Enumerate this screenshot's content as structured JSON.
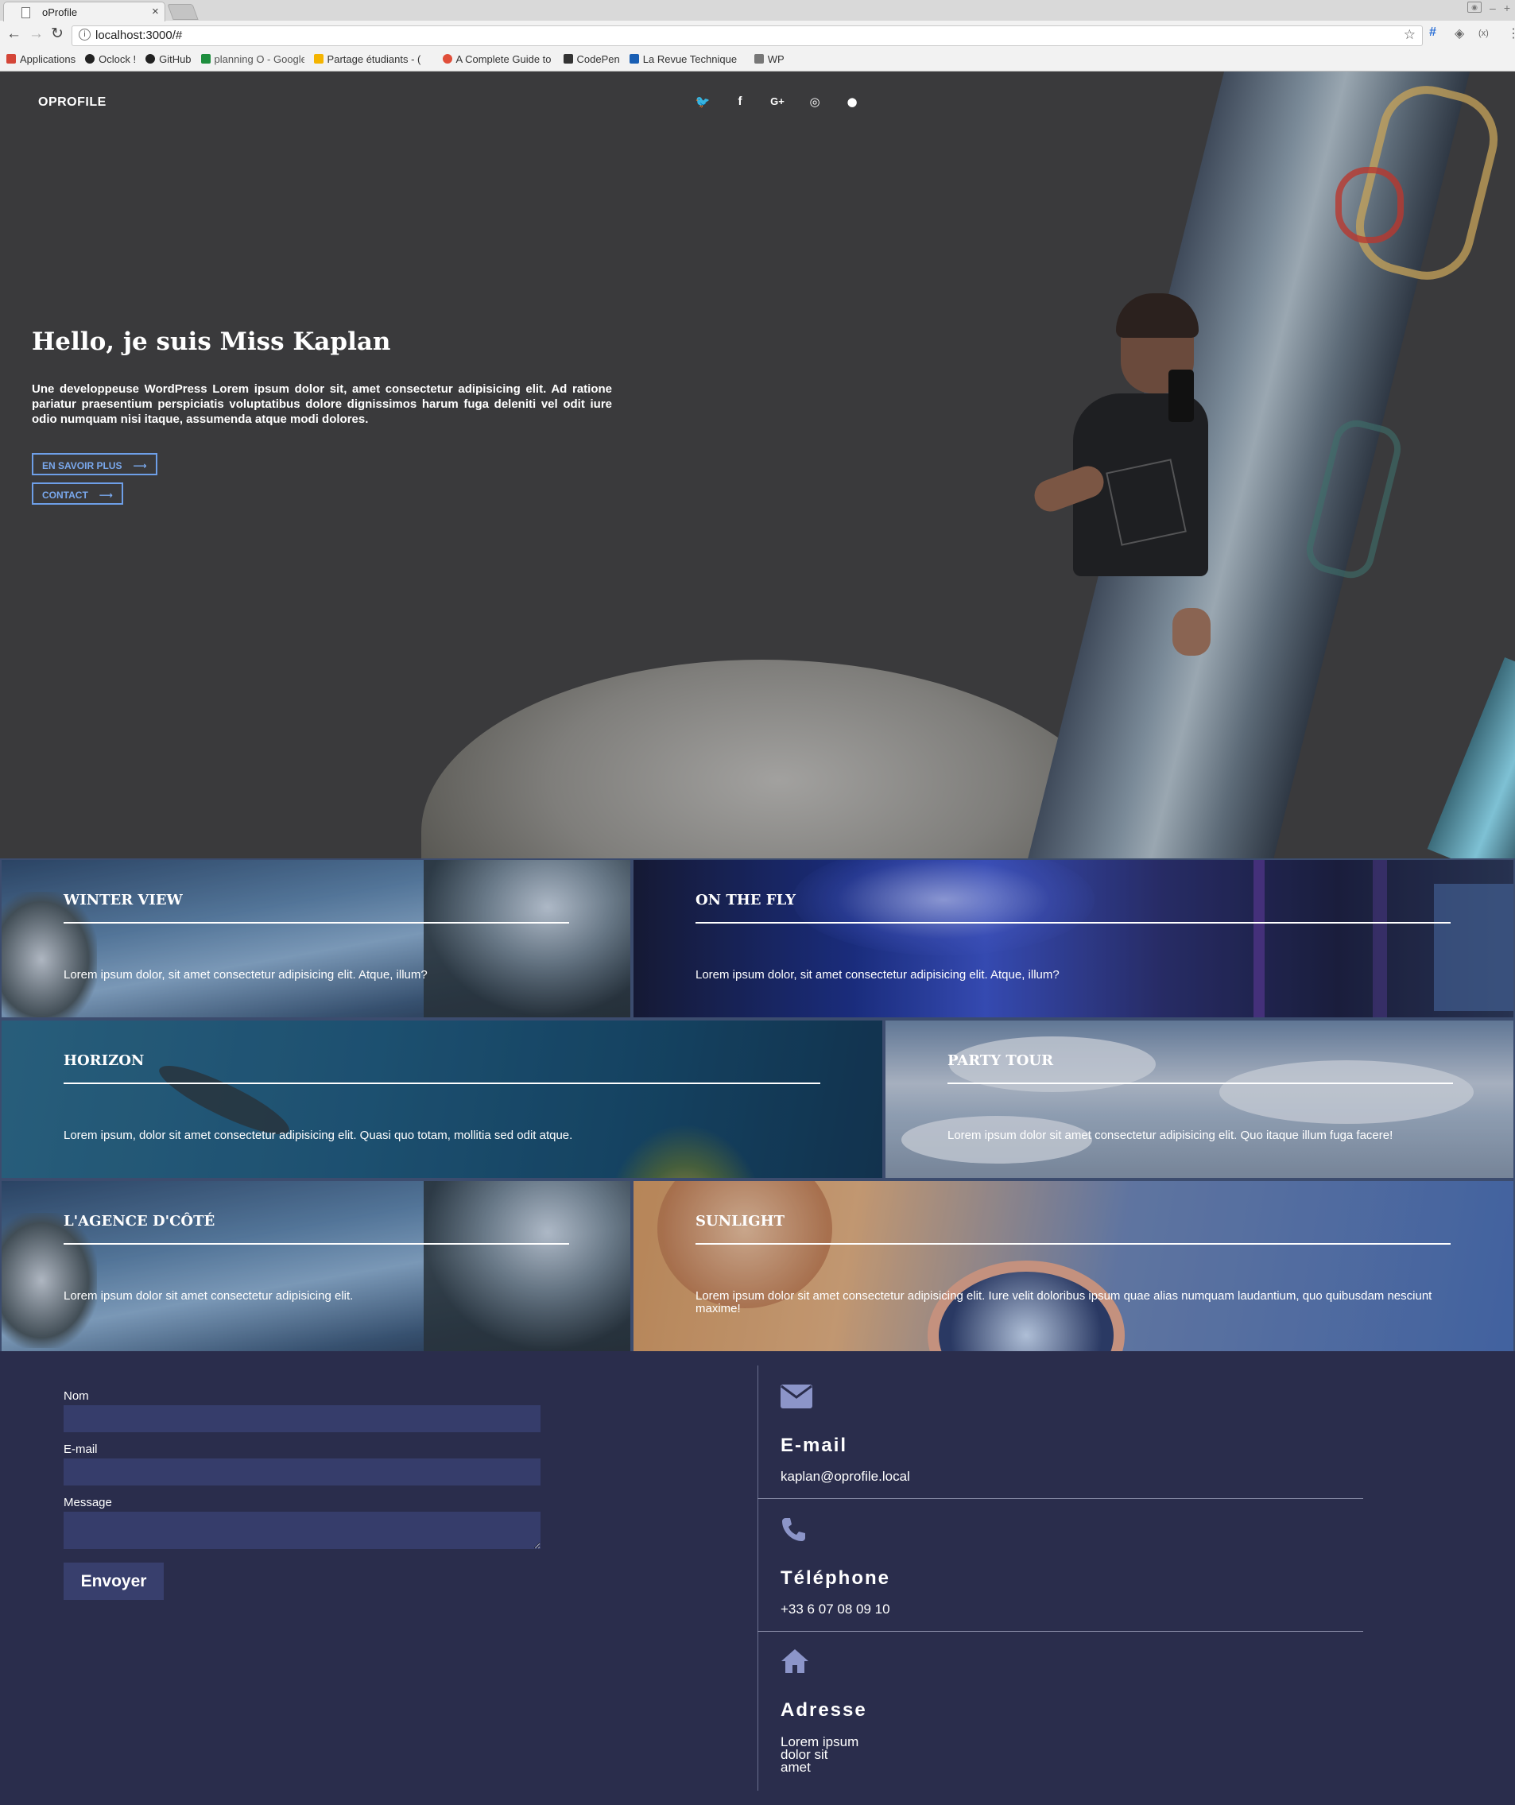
{
  "browser": {
    "tab_title": "oProfile",
    "url": "localhost:3000/#",
    "bookmarks": [
      {
        "label": "Applications",
        "color": "#d44638"
      },
      {
        "label": "Oclock !",
        "color": "#222222"
      },
      {
        "label": "GitHub",
        "color": "#222222"
      },
      {
        "label": "planning O - Google",
        "color": "#1e8e3e"
      },
      {
        "label": "Partage étudiants - (",
        "color": "#f4b400"
      },
      {
        "label": "A Complete Guide to",
        "color": "#e04e39"
      },
      {
        "label": "CodePen",
        "color": "#333333"
      },
      {
        "label": "La Revue Technique",
        "color": "#1a5fb4"
      },
      {
        "label": "WP",
        "color": "#777777"
      }
    ]
  },
  "site": {
    "brand": "OPROFILE",
    "social_icons": [
      "twitter-icon",
      "facebook-icon",
      "google-plus-icon",
      "instagram-icon",
      "github-icon"
    ]
  },
  "hero": {
    "title": "Hello, je suis Miss Kaplan",
    "intro": "Une developpeuse WordPress Lorem ipsum dolor sit, amet consectetur adipisicing elit. Ad ratione pariatur praesentium perspiciatis voluptatibus dolore dignissimos harum fuga deleniti vel odit iure odio numquam nisi itaque, assumenda atque modi dolores.",
    "btn_more": "EN SAVOIR PLUS",
    "btn_contact": "CONTACT"
  },
  "projects": [
    {
      "title": "WINTER VIEW",
      "text": "Lorem ipsum dolor, sit amet consectetur adipisicing elit. Atque, illum?"
    },
    {
      "title": "ON THE FLY",
      "text": "Lorem ipsum dolor, sit amet consectetur adipisicing elit. Atque, illum?"
    },
    {
      "title": "HORIZON",
      "text": "Lorem ipsum, dolor sit amet consectetur adipisicing elit. Quasi quo totam, mollitia sed odit atque."
    },
    {
      "title": "PARTY TOUR",
      "text": "Lorem ipsum dolor sit amet consectetur adipisicing elit. Quo itaque illum fuga facere!"
    },
    {
      "title": "L'AGENCE D'CÔTÉ",
      "text": "Lorem ipsum dolor sit amet consectetur adipisicing elit."
    },
    {
      "title": "SUNLIGHT",
      "text": "Lorem ipsum dolor sit amet consectetur adipisicing elit. Iure velit doloribus ipsum quae alias numquam laudantium, quo quibusdam nesciunt maxime!"
    }
  ],
  "contact_form": {
    "name_label": "Nom",
    "email_label": "E-mail",
    "message_label": "Message",
    "submit_label": "Envoyer"
  },
  "contact_info": {
    "email": {
      "title": "E-mail",
      "value": "kaplan@oprofile.local"
    },
    "phone": {
      "title": "Téléphone",
      "value": "+33 6 07 08 09 10"
    },
    "address": {
      "title": "Adresse",
      "lines": [
        "Lorem ipsum",
        "dolor sit",
        "amet"
      ]
    }
  }
}
